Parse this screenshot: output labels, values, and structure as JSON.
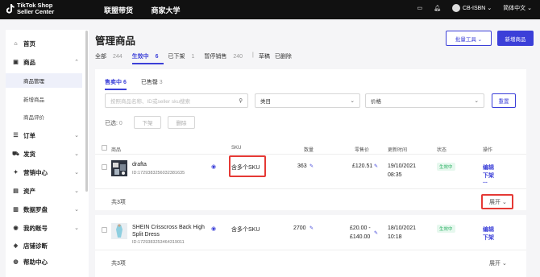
{
  "topbar": {
    "logo_line1": "TikTok Shop",
    "logo_line2": "Seller Center",
    "nav": [
      "联盟带货",
      "商家大学"
    ],
    "account": "CB-ISBN",
    "language": "简体中文"
  },
  "sidebar": {
    "items": [
      {
        "icon": "home-icon",
        "glyph": "⌂",
        "label": "首页"
      },
      {
        "icon": "bag-icon",
        "glyph": "▣",
        "label": "商品",
        "chev": "⌃"
      },
      {
        "label": "商品管理"
      },
      {
        "label": "新增商品"
      },
      {
        "label": "商品评价"
      },
      {
        "icon": "order-icon",
        "glyph": "☰",
        "label": "订单",
        "chev": "⌄"
      },
      {
        "icon": "shipping-icon",
        "glyph": "⛟",
        "label": "发货",
        "chev": "⌄"
      },
      {
        "icon": "marketing-icon",
        "glyph": "✦",
        "label": "营销中心",
        "chev": "⌄"
      },
      {
        "icon": "finance-icon",
        "glyph": "▤",
        "label": "资产",
        "chev": "⌄"
      },
      {
        "icon": "data-icon",
        "glyph": "▥",
        "label": "数据罗盘",
        "chev": "⌄"
      },
      {
        "icon": "account-icon",
        "glyph": "◉",
        "label": "我的账号",
        "chev": "⌄"
      },
      {
        "icon": "diagnose-icon",
        "glyph": "◈",
        "label": "店铺诊断"
      },
      {
        "icon": "help-icon",
        "glyph": "◍",
        "label": "帮助中心"
      }
    ]
  },
  "main": {
    "title": "管理商品",
    "batch_label": "批量工具 ⌄",
    "add_label": "新增商品",
    "tabs": [
      {
        "label": "全部",
        "count": "244"
      },
      {
        "label": "生效中",
        "count": "6"
      },
      {
        "label": "已下架",
        "count": "1"
      },
      {
        "label": "暂停销售",
        "count": "240"
      },
      {
        "label": "|",
        "count": ""
      },
      {
        "label": "草稿",
        "count": ""
      },
      {
        "label": "已删除",
        "count": ""
      }
    ]
  },
  "card": {
    "subtab_active": "售卖中 6",
    "subtab_other_label": "已售罄",
    "subtab_other_count": "3",
    "search_placeholder": "按照商品名称、ID或seller sku搜索",
    "category_label": "类目",
    "price_label": "价格",
    "reset_label": "重置",
    "selected_label": "已选:",
    "selected_count": "0",
    "delist_label": "下架",
    "delete_label": "删除",
    "columns": [
      "商品",
      "SKU",
      "数量",
      "零售价",
      "更新时间",
      "状态",
      "操作"
    ],
    "products": [
      {
        "name": "drafta",
        "id": "ID:1729383256032381635",
        "sku": "含多个SKU",
        "qty": "363",
        "price_line1": "£120.51",
        "price_line2": "",
        "date": "19/10/2021",
        "time": "08:35",
        "status": "生效中",
        "action1": "编辑",
        "action2": "下架",
        "action3": "..."
      },
      {
        "name": "SHEIN Crisscross Back High Split Dress",
        "id": "ID:1729383253464319011",
        "sku": "含多个SKU",
        "qty": "2700",
        "price_line1": "£20.00 -",
        "price_line2": "£140.00",
        "date": "18/10/2021",
        "time": "10:18",
        "status": "生效中",
        "action1": "编辑",
        "action2": "下架",
        "action3": ""
      }
    ],
    "total_label": "共3项",
    "expand_label": "展开",
    "chev": "⌄"
  },
  "colors": {
    "accent": "#3b3fd8",
    "highlight": "#e53935",
    "status_green": "#27ae60"
  }
}
